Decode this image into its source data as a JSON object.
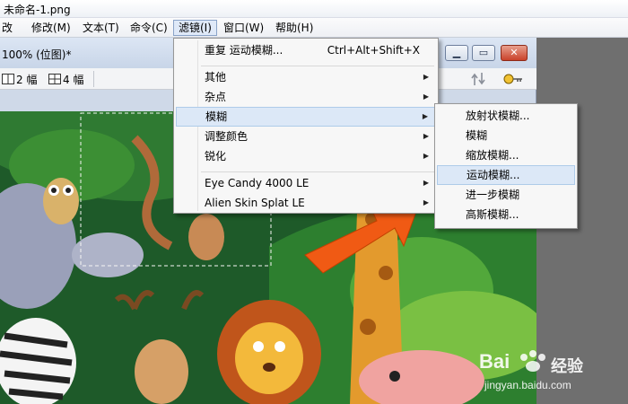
{
  "window": {
    "title": "未命名-1.png"
  },
  "menubar": {
    "items": [
      {
        "label": "修改(M)"
      },
      {
        "label": "文本(T)"
      },
      {
        "label": "命令(C)"
      },
      {
        "label": "滤镜(I)",
        "active": true
      },
      {
        "label": "窗口(W)"
      },
      {
        "label": "帮助(H)"
      }
    ],
    "partial_left": "改"
  },
  "document": {
    "title": "100% (位图)*",
    "buttons": {
      "minimize": "▁",
      "restore": "▭",
      "close": "✕"
    }
  },
  "toolbar": {
    "view2_label": "2 幅",
    "view4_label": "4 幅",
    "icons": [
      "export-icon",
      "key-icon"
    ]
  },
  "filter_menu": {
    "items": [
      {
        "label": "重复 运动模糊...",
        "shortcut": "Ctrl+Alt+Shift+X"
      },
      {
        "label": "其他",
        "submenu": true
      },
      {
        "label": "杂点",
        "submenu": true
      },
      {
        "label": "模糊",
        "submenu": true,
        "highlighted": true
      },
      {
        "label": "调整颜色",
        "submenu": true
      },
      {
        "label": "锐化",
        "submenu": true
      },
      {
        "label": "Eye Candy 4000 LE",
        "submenu": true
      },
      {
        "label": "Alien Skin Splat LE",
        "submenu": true
      }
    ]
  },
  "blur_submenu": {
    "items": [
      {
        "label": "放射状模糊..."
      },
      {
        "label": "模糊"
      },
      {
        "label": "缩放模糊..."
      },
      {
        "label": "运动模糊...",
        "highlighted": true
      },
      {
        "label": "进一步模糊"
      },
      {
        "label": "高斯模糊..."
      }
    ]
  },
  "watermark": {
    "brand": "Bai",
    "brand_cn": "经验",
    "url": "jingyan.baidu.com"
  },
  "colors": {
    "accent_arrow": "#f05a14",
    "highlight": "#dce8f7"
  }
}
